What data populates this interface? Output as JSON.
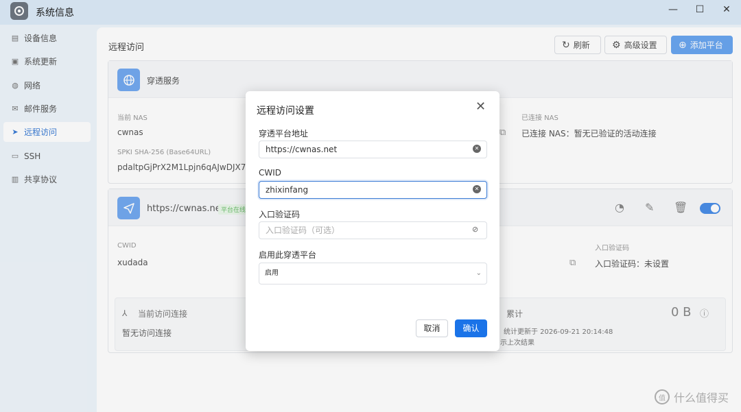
{
  "window": {
    "title": "系统信息",
    "minimize": "—",
    "maximize": "☐",
    "close": "✕"
  },
  "sidebar": {
    "items": [
      {
        "label": "设备信息",
        "icon": "storage-icon"
      },
      {
        "label": "系统更新",
        "icon": "update-icon"
      },
      {
        "label": "网络",
        "icon": "globe-icon"
      },
      {
        "label": "邮件服务",
        "icon": "mail-icon"
      },
      {
        "label": "远程访问",
        "icon": "send-icon",
        "active": true
      },
      {
        "label": "SSH",
        "icon": "terminal-icon"
      },
      {
        "label": "共享协议",
        "icon": "file-icon"
      }
    ]
  },
  "main": {
    "title": "远程访问",
    "toolbar": {
      "refresh": "刷新",
      "advanced": "高级设置",
      "add": "添加平台"
    },
    "card1": {
      "title": "穿透服务",
      "current_nas_label": "当前 NAS",
      "current_nas_value": "cwnas",
      "spki_label": "SPKI SHA-256 (Base64URL)",
      "spki_value": "pdaltpGjPrX2M1Lpjn6qAJwDJX7xh",
      "connected_label": "已连接 NAS",
      "connected_value": "已连接 NAS：暂无已验证的活动连接"
    },
    "card2": {
      "title": "https://cwnas.net",
      "badge": "平台在线",
      "cwid_label": "CWID",
      "cwid_value": "xudada",
      "code_label": "入口验证码",
      "code_value": "入口验证码：未设置",
      "current_conn_label": "当前访问连接",
      "current_conn_value": "暂无访问连接",
      "total_label": "累计",
      "total_value": "0 B",
      "stats_updated": "统计更新于 2026-09-21 20:14:48",
      "stats_note": "示上次结果"
    }
  },
  "dialog": {
    "title": "远程访问设置",
    "platform_label": "穿透平台地址",
    "platform_value": "https://cwnas.net",
    "cwid_label": "CWID",
    "cwid_value": "zhixinfang",
    "code_label": "入口验证码",
    "code_placeholder": "入口验证码（可选）",
    "enable_label": "启用此穿透平台",
    "enable_value": "启用",
    "cancel": "取消",
    "confirm": "确认"
  },
  "watermark": {
    "text": "什么值得买",
    "logo": "值"
  },
  "colors": {
    "accent": "#1a73e8",
    "sidebar_active": "#3a7bd5",
    "toggle": "#4a8ee8",
    "online": "#6bbf6b"
  }
}
